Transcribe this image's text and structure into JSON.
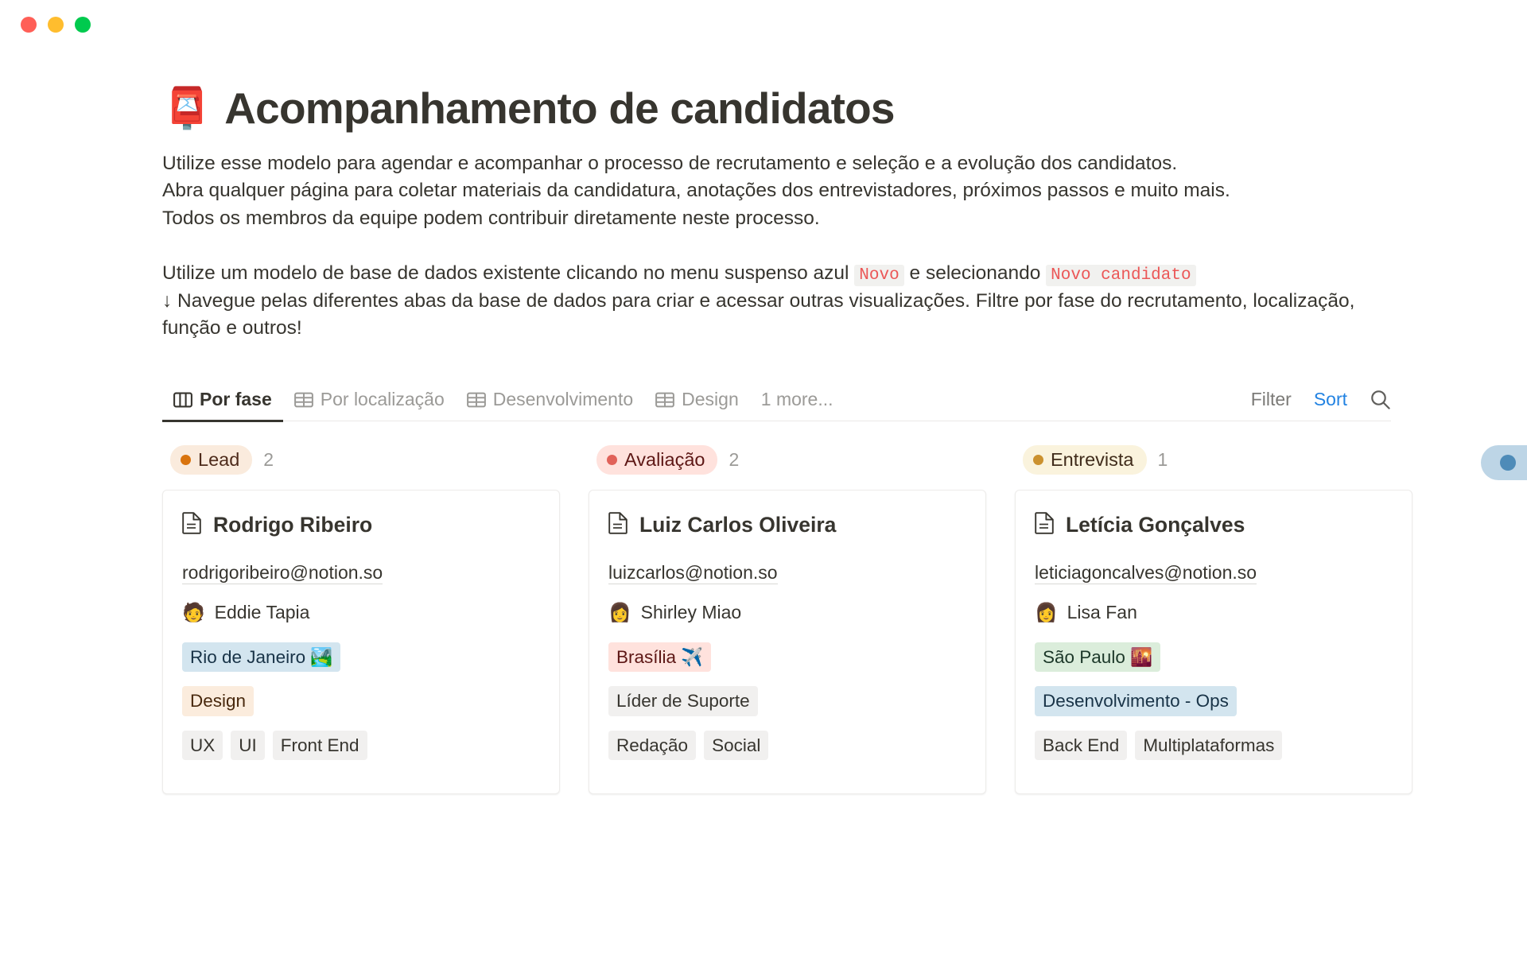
{
  "window": {
    "traffic_lights": [
      {
        "name": "close",
        "color": "#FF5F57"
      },
      {
        "name": "minimize",
        "color": "#FFBD2E"
      },
      {
        "name": "maximize",
        "color": "#00CA4E"
      }
    ]
  },
  "header": {
    "emoji": "📮",
    "emoji_name": "postbox-emoji",
    "title": "Acompanhamento de candidatos"
  },
  "body": {
    "para1": "Utilize esse modelo para agendar e acompanhar o processo de recrutamento e seleção e a evolução dos candidatos.",
    "para2": "Abra qualquer página para coletar materiais da candidatura, anotações dos entrevistadores, próximos passos e muito mais.",
    "para3": "Todos os membros da equipe podem contribuir diretamente neste processo.",
    "para4_part1": "Utilize um modelo de base de dados existente clicando no menu suspenso azul ",
    "para4_code1": "Novo",
    "para4_part2": " e selecionando ",
    "para4_code2": "Novo candidato",
    "para5": "↓ Navegue pelas diferentes abas da base de dados para criar e acessar outras visualizações. Filtre por fase do recrutamento, localização, função e outros!"
  },
  "toolbar": {
    "tabs": [
      {
        "label": "Por fase",
        "icon": "board-view-icon",
        "active": true
      },
      {
        "label": "Por localização",
        "icon": "table-view-icon",
        "active": false
      },
      {
        "label": "Desenvolvimento",
        "icon": "table-view-icon",
        "active": false
      },
      {
        "label": "Design",
        "icon": "table-view-icon",
        "active": false
      }
    ],
    "more_label": "1 more...",
    "filter_label": "Filter",
    "sort_label": "Sort",
    "search_icon": "search-icon",
    "accent_color": "#2383E2"
  },
  "board": {
    "columns": [
      {
        "status": "Lead",
        "count": "2",
        "pill_bg": "#FAEBDD",
        "pill_text": "#4E2B1B",
        "dot_color": "#D9730D",
        "card": {
          "title": "Rodrigo Ribeiro",
          "doc_icon": "page-icon",
          "email": "rodrigoribeiro@notion.so",
          "person_emoji": "🧑",
          "person": "Eddie Tapia",
          "location": {
            "label": "Rio de Janeiro 🏞️",
            "bg": "#D3E5EF",
            "color": "#183347"
          },
          "team": {
            "label": "Design",
            "bg": "#FBECDD",
            "color": "#49290E"
          },
          "skills": [
            "UX",
            "UI",
            "Front End"
          ]
        }
      },
      {
        "status": "Avaliação",
        "count": "2",
        "pill_bg": "#FFE2DD",
        "pill_text": "#5D1715",
        "dot_color": "#E16259",
        "card": {
          "title": "Luiz Carlos Oliveira",
          "doc_icon": "page-icon",
          "email": "luizcarlos@notion.so",
          "person_emoji": "👩",
          "person": "Shirley Miao",
          "location": {
            "label": "Brasília ✈️",
            "bg": "#FFE2DD",
            "color": "#5D1715"
          },
          "team": {
            "label": "Líder de Suporte",
            "bg": "#F1F0EF",
            "color": "#37352F"
          },
          "skills": [
            "Redação",
            "Social"
          ]
        }
      },
      {
        "status": "Entrevista",
        "count": "1",
        "pill_bg": "#FAF3DD",
        "pill_text": "#402C1B",
        "dot_color": "#CB912F",
        "card": {
          "title": "Letícia Gonçalves",
          "doc_icon": "page-icon",
          "email": "leticiagoncalves@notion.so",
          "person_emoji": "👩",
          "person": "Lisa Fan",
          "location": {
            "label": "São Paulo 🌇",
            "bg": "#DBEDDB",
            "color": "#1C3829"
          },
          "team": {
            "label": "Desenvolvimento - Ops",
            "bg": "#D3E5EF",
            "color": "#183347"
          },
          "skills": [
            "Back End",
            "Multiplataformas"
          ]
        }
      }
    ]
  },
  "cursor": {
    "name": "cursor-indicator",
    "color": "#4E8BB8"
  }
}
